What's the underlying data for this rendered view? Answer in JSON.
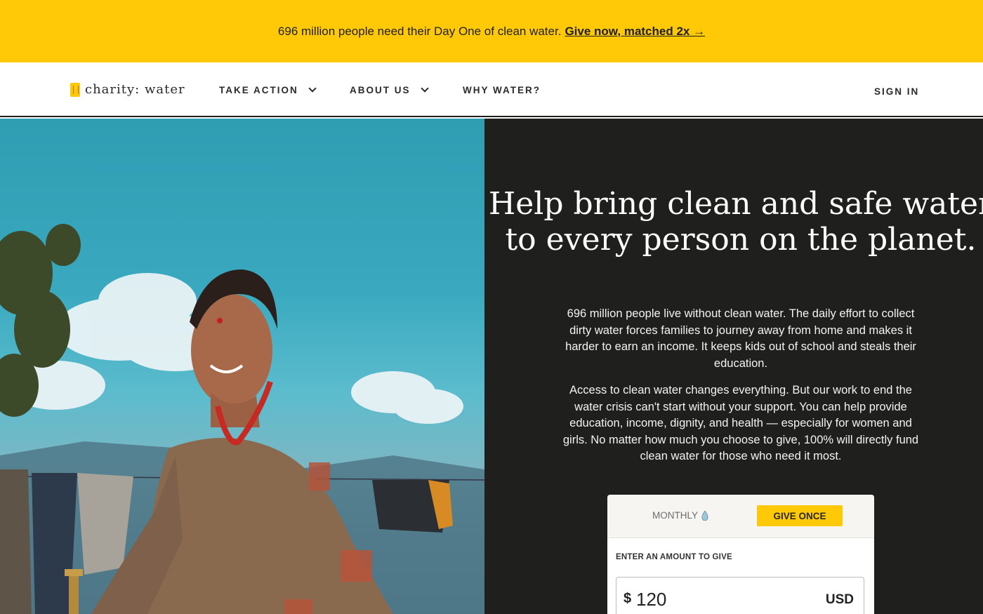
{
  "banner": {
    "message": "696 million people need their Day One of clean water.",
    "cta": "Give now, matched 2x →"
  },
  "nav": {
    "logo_text": "charity: water",
    "items": [
      {
        "label": "TAKE ACTION",
        "has_dropdown": true
      },
      {
        "label": "ABOUT US",
        "has_dropdown": true
      },
      {
        "label": "WHY WATER?",
        "has_dropdown": false
      }
    ],
    "sign_in": "SIGN IN"
  },
  "hero": {
    "headline": "Help bring clean and safe water to every person on the planet.",
    "paragraph1": "696 million people live without clean water. The daily effort to collect dirty water forces families to journey away from home and makes it harder to earn an income. It keeps kids out of school and steals their education.",
    "paragraph2": "Access to clean water changes everything. But our work to end the water crisis can't start without your support. You can help provide education, income, dignity, and health — especially for women and girls. No matter how much you choose to give, 100% will directly fund clean water for those who need it most."
  },
  "donation": {
    "tab_monthly": "MONTHLY",
    "tab_once": "GIVE ONCE",
    "selected_tab": "GIVE ONCE",
    "amount_label": "ENTER AN AMOUNT TO GIVE",
    "currency_symbol": "$",
    "amount": "120",
    "currency": "USD"
  },
  "colors": {
    "brand_yellow": "#ffc907",
    "hero_dark": "#1f1f1d"
  },
  "icons": {
    "nav_dropdown": "chevron-down-icon",
    "monthly_tab": "water-drop-icon",
    "logo": "jerry-can-icon"
  }
}
